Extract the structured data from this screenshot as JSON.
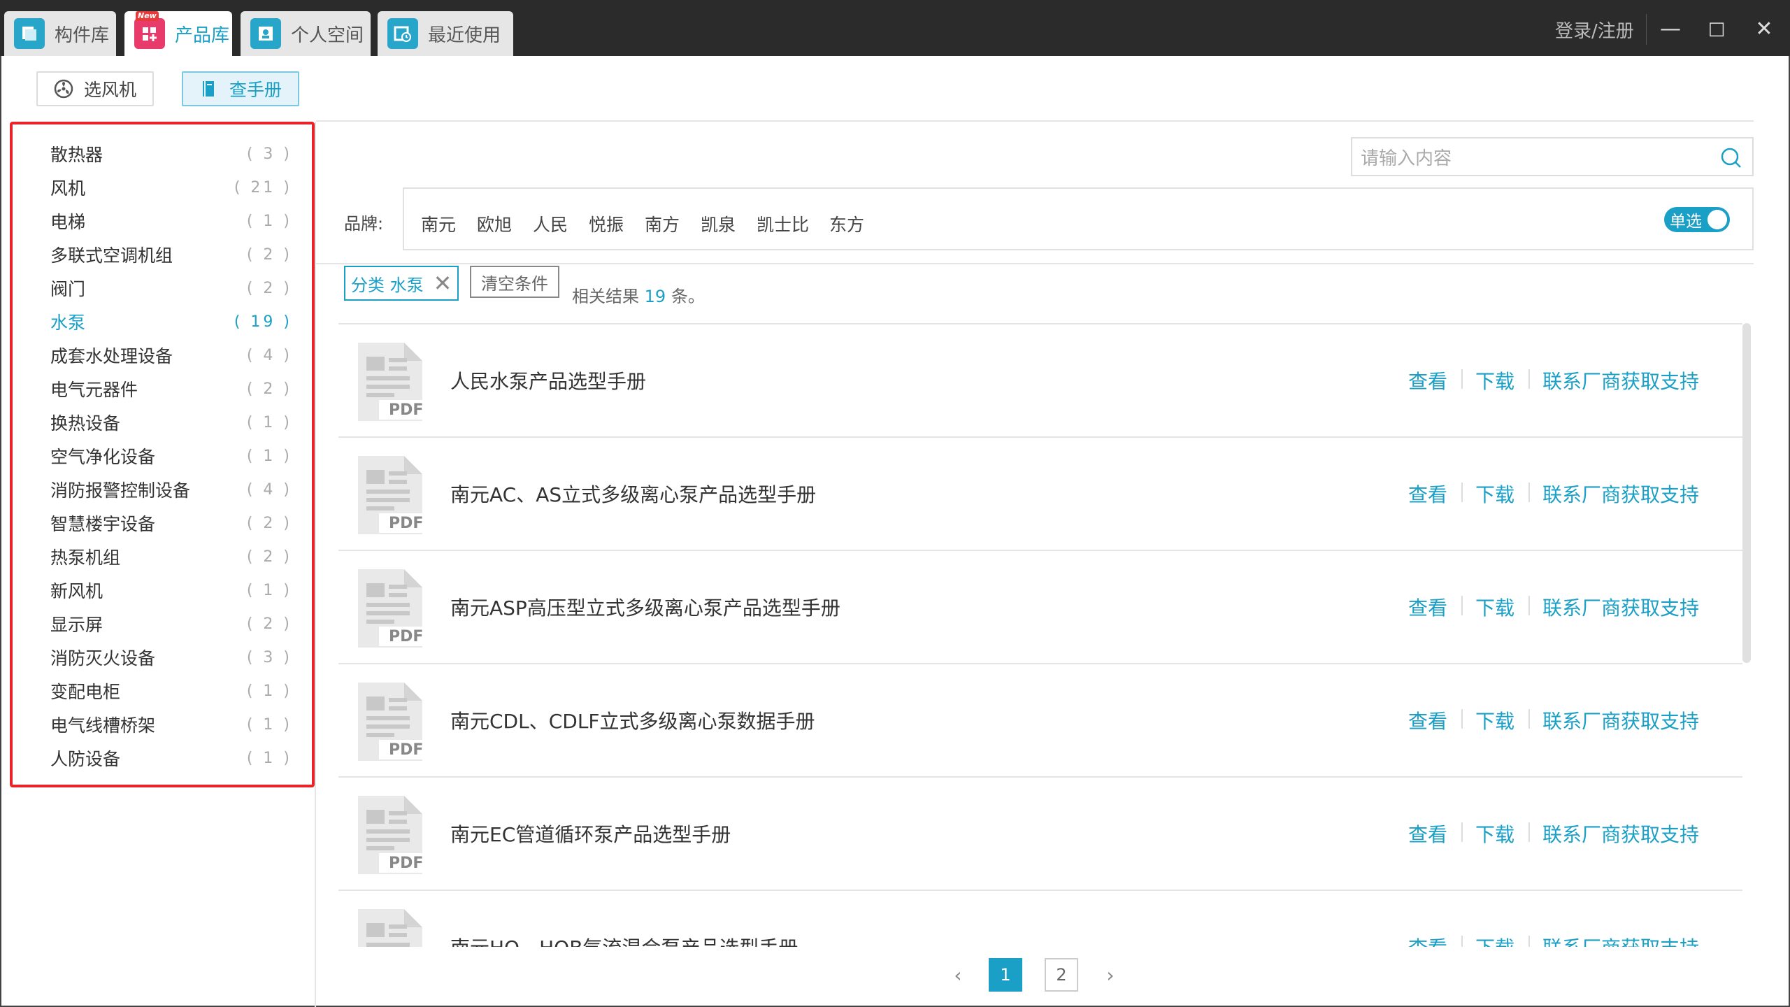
{
  "tabs": [
    {
      "label": "构件库",
      "icon": "component-library-icon",
      "active": false
    },
    {
      "label": "产品库",
      "icon": "product-library-icon",
      "active": true,
      "badge": "New"
    },
    {
      "label": "个人空间",
      "icon": "personal-space-icon",
      "active": false
    },
    {
      "label": "最近使用",
      "icon": "recent-icon",
      "active": false
    }
  ],
  "header": {
    "login": "登录/注册"
  },
  "subnav": {
    "select_fan": "选风机",
    "manual": "查手册"
  },
  "categories": [
    {
      "name": "散热器",
      "count": "( 3 )"
    },
    {
      "name": "风机",
      "count": "( 21 )"
    },
    {
      "name": "电梯",
      "count": "( 1 )"
    },
    {
      "name": "多联式空调机组",
      "count": "( 2 )"
    },
    {
      "name": "阀门",
      "count": "( 2 )"
    },
    {
      "name": "水泵",
      "count": "( 19 )",
      "active": true
    },
    {
      "name": "成套水处理设备",
      "count": "( 4 )"
    },
    {
      "name": "电气元器件",
      "count": "( 2 )"
    },
    {
      "name": "换热设备",
      "count": "( 1 )"
    },
    {
      "name": "空气净化设备",
      "count": "( 1 )"
    },
    {
      "name": "消防报警控制设备",
      "count": "( 4 )"
    },
    {
      "name": "智慧楼宇设备",
      "count": "( 2 )"
    },
    {
      "name": "热泵机组",
      "count": "( 2 )"
    },
    {
      "name": "新风机",
      "count": "( 1 )"
    },
    {
      "name": "显示屏",
      "count": "( 2 )"
    },
    {
      "name": "消防灭火设备",
      "count": "( 3 )"
    },
    {
      "name": "变配电柜",
      "count": "( 1 )"
    },
    {
      "name": "电气线槽桥架",
      "count": "( 1 )"
    },
    {
      "name": "人防设备",
      "count": "( 1 )"
    }
  ],
  "search": {
    "placeholder": "请输入内容"
  },
  "brand": {
    "label": "品牌:",
    "items": [
      "南元",
      "欧旭",
      "人民",
      "悦振",
      "南方",
      "凯泉",
      "凯士比",
      "东方"
    ],
    "toggle": "单选"
  },
  "filter": {
    "chip": "分类 水泵",
    "clear": "清空条件",
    "result_prefix": "相关结果",
    "result_count": "19",
    "result_suffix": "条。"
  },
  "actions": {
    "view": "查看",
    "download": "下载",
    "contact": "联系厂商获取支持"
  },
  "pdf_label": "PDF",
  "manuals": [
    "人民水泵产品选型手册",
    "南元AC、AS立式多级离心泵产品选型手册",
    "南元ASP高压型立式多级离心泵产品选型手册",
    "南元CDL、CDLF立式多级离心泵数据手册",
    "南元EC管道循环泵产品选型手册",
    "南元HQ、HQB气流混合泵产品选型手册"
  ],
  "pagination": {
    "pages": [
      "1",
      "2"
    ],
    "current": "1",
    "prev": "‹",
    "next": "›"
  },
  "colors": {
    "accent": "#1a9fc6",
    "titlebar": "#2b2b2b",
    "highlight": "#e8242a"
  }
}
